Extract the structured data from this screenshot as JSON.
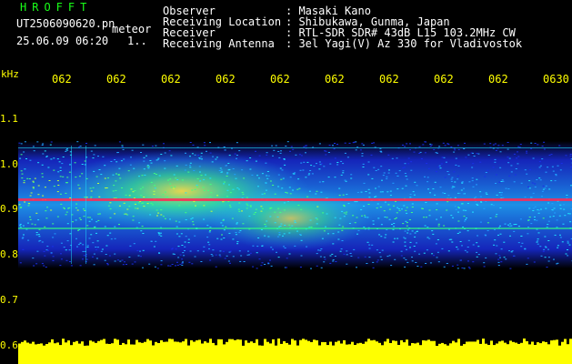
{
  "header": {
    "brand": "HROFFT",
    "filename": "UT2506090620.pn",
    "filename_suffix": "meteor",
    "datetime": "25.06.09 06:20",
    "count": "1.."
  },
  "info": [
    {
      "label": "Observer",
      "value": ": Masaki Kano"
    },
    {
      "label": "Receiving Location",
      "value": ": Shibukawa, Gunma, Japan"
    },
    {
      "label": "Receiver",
      "value": ": RTL-SDR SDR# 43dB L15 103.2MHz CW"
    },
    {
      "label": "Receiving Antenna",
      "value": ": 3el Yagi(V) Az 330 for Vladivostok"
    }
  ],
  "axis": {
    "unit": "kHz",
    "y_ticks": [
      "1.1",
      "1.0",
      "0.9",
      "0.8",
      "0.7",
      "0.6"
    ],
    "x_ticks": [
      "062",
      "062",
      "062",
      "062",
      "062",
      "062",
      "062",
      "062",
      "062",
      "0630"
    ]
  },
  "colors": {
    "text_green": "#19ff19",
    "tick_yellow": "#ffff00",
    "background": "#000000",
    "echo_red": "#ff2a55",
    "noise_blue": "#1a2fe8",
    "noise_cyan": "#20e0ff"
  }
}
